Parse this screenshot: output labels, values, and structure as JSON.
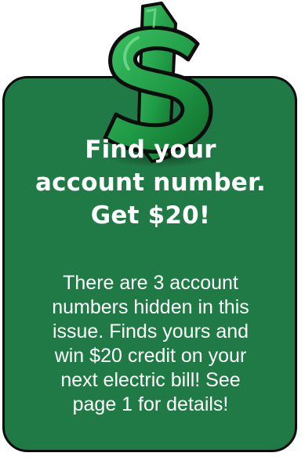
{
  "headline": {
    "lines": [
      "Find your",
      "account number.",
      "Get $20!"
    ]
  },
  "body": {
    "lines": [
      "There are 3 account",
      "numbers hidden in this",
      "issue. Finds yours and",
      "win $20 credit on your",
      "next electric bill! See",
      "page 1 for details!"
    ]
  },
  "colors": {
    "card_green": "#1f7a45",
    "dollar_green": "#21a24b",
    "outline": "#0d0d0d",
    "text": "#ffffff"
  },
  "icons": {
    "dollar": "dollar-sign-icon"
  }
}
